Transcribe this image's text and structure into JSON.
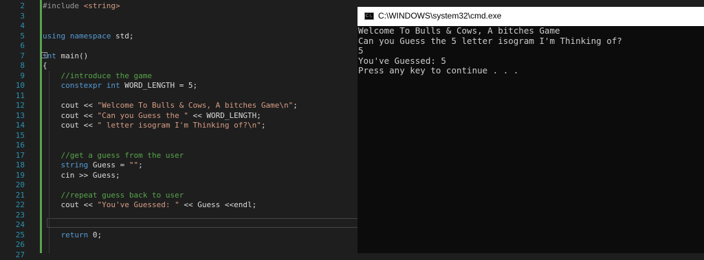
{
  "editor": {
    "line_numbers": [
      "2",
      "3",
      "4",
      "5",
      "6",
      "7",
      "8",
      "9",
      "10",
      "11",
      "12",
      "13",
      "14",
      "15",
      "16",
      "17",
      "18",
      "19",
      "20",
      "21",
      "22",
      "23",
      "24",
      "25",
      "26",
      "27"
    ],
    "lines": [
      [
        {
          "t": "#include ",
          "c": "pp"
        },
        {
          "t": "<string>",
          "c": "str"
        }
      ],
      [],
      [],
      [
        {
          "t": "using namespace ",
          "c": "kw"
        },
        {
          "t": "std;",
          "c": ""
        }
      ],
      [],
      [
        {
          "t": "int ",
          "c": "kw"
        },
        {
          "t": "main()",
          "c": ""
        }
      ],
      [
        {
          "t": "{",
          "c": ""
        }
      ],
      [
        {
          "t": "    //introduce the game",
          "c": "cmt"
        }
      ],
      [
        {
          "t": "    constexpr int ",
          "c": "kw"
        },
        {
          "t": "WORD_LENGTH = 5;",
          "c": ""
        }
      ],
      [],
      [
        {
          "t": "    cout << ",
          "c": ""
        },
        {
          "t": "\"Welcome To Bulls & Cows, A bitches Game\\n\"",
          "c": "str"
        },
        {
          "t": ";",
          "c": ""
        }
      ],
      [
        {
          "t": "    cout << ",
          "c": ""
        },
        {
          "t": "\"Can you Guess the \"",
          "c": "str"
        },
        {
          "t": " << WORD_LENGTH;",
          "c": ""
        }
      ],
      [
        {
          "t": "    cout << ",
          "c": ""
        },
        {
          "t": "\" letter isogram I'm Thinking of?\\n\"",
          "c": "str"
        },
        {
          "t": ";",
          "c": ""
        }
      ],
      [],
      [],
      [
        {
          "t": "    //get a guess from the user",
          "c": "cmt"
        }
      ],
      [
        {
          "t": "    string ",
          "c": "kw"
        },
        {
          "t": "Guess = ",
          "c": ""
        },
        {
          "t": "\"\"",
          "c": "str"
        },
        {
          "t": ";",
          "c": ""
        }
      ],
      [
        {
          "t": "    cin >> Guess;",
          "c": ""
        }
      ],
      [],
      [
        {
          "t": "    //repeat guess back to user",
          "c": "cmt"
        }
      ],
      [
        {
          "t": "    cout << ",
          "c": ""
        },
        {
          "t": "\"You've Guessed: \"",
          "c": "str"
        },
        {
          "t": " << Guess <<endl;",
          "c": ""
        }
      ],
      [],
      [],
      [
        {
          "t": "    return ",
          "c": "kw"
        },
        {
          "t": "0;",
          "c": ""
        }
      ],
      [],
      []
    ]
  },
  "console": {
    "title": "C:\\WINDOWS\\system32\\cmd.exe",
    "icon": "cmd-icon",
    "icon_text": "C:\\.",
    "output": [
      "Welcome To Bulls & Cows, A bitches Game",
      "Can you Guess the 5 letter isogram I'm Thinking of?",
      "5",
      "You've Guessed: 5",
      "Press any key to continue . . ."
    ]
  }
}
